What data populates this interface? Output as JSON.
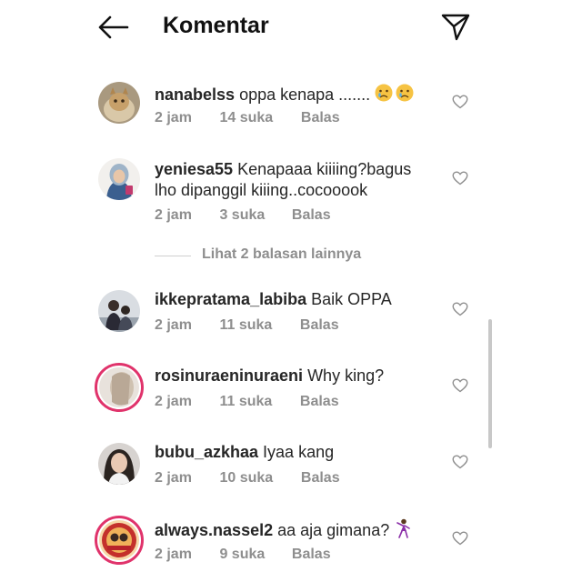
{
  "header": {
    "title": "Komentar",
    "back_icon": "arrow-left-icon",
    "send_icon": "paper-plane-icon"
  },
  "comments": [
    {
      "username": "nanabelss",
      "text": "oppa kenapa .......",
      "emoji": "crying-face x2",
      "time": "2 jam",
      "likes": "14 suka",
      "reply": "Balas"
    },
    {
      "username": "yeniesa55",
      "text": "Kenapaaa kiiiing?bagus lho dipanggil kiiing..cocooook",
      "time": "2 jam",
      "likes": "3 suka",
      "reply": "Balas"
    },
    {
      "username": "ikkepratama_labiba",
      "text": "Baik OPPA",
      "time": "2 jam",
      "likes": "11 suka",
      "reply": "Balas"
    },
    {
      "username": "rosinuraeninuraeni",
      "text": "Why king?",
      "time": "2 jam",
      "likes": "11 suka",
      "reply": "Balas"
    },
    {
      "username": "bubu_azkhaa",
      "text": "Iyaa kang",
      "time": "2 jam",
      "likes": "10 suka",
      "reply": "Balas"
    },
    {
      "username": "always.nassel2",
      "text": "aa aja gimana?",
      "emoji": "woman-dancing",
      "time": "2 jam",
      "likes": "9 suka",
      "reply": "Balas"
    }
  ],
  "view_replies": "Lihat 2 balasan lainnya",
  "colors": {
    "text": "#262626",
    "meta": "#8e8e8e",
    "story_ring": "#e0336b"
  }
}
